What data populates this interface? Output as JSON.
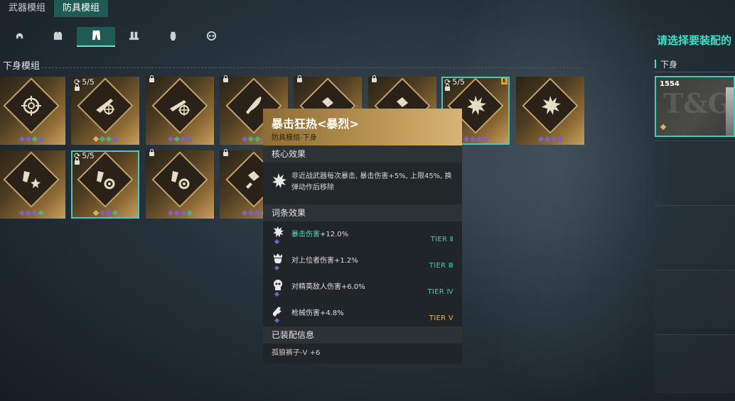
{
  "tabs": [
    {
      "label": "武器模组",
      "active": false
    },
    {
      "label": "防具模组",
      "active": true
    }
  ],
  "categories": [
    {
      "icon": "helmet-icon",
      "active": false
    },
    {
      "icon": "chest-armor-icon",
      "active": false
    },
    {
      "icon": "pants-icon",
      "active": true
    },
    {
      "icon": "boots-icon",
      "active": false
    },
    {
      "icon": "gloves-icon",
      "active": false
    },
    {
      "icon": "mask-icon",
      "active": false
    }
  ],
  "section_label": "下身模组",
  "cards": [
    {
      "icon": "target-icon",
      "counter": "",
      "locked": false,
      "selected": false,
      "badge": "",
      "dots": [
        "#7a63c4",
        "#7a63c4",
        "#4fae80",
        "#7a63c4"
      ]
    },
    {
      "icon": "sniper-rifle-icon",
      "counter": "5/5",
      "locked": true,
      "selected": false,
      "badge": "",
      "dots": [
        "#d8b35e",
        "#4fae80",
        "#4fae80",
        "#7a63c4"
      ]
    },
    {
      "icon": "rifle-target-icon",
      "counter": "",
      "locked": true,
      "selected": false,
      "badge": "",
      "dots": [
        "#7a63c4",
        "#4fae80",
        "#7a63c4",
        "#7a63c4"
      ]
    },
    {
      "icon": "knife-icon",
      "counter": "",
      "locked": true,
      "selected": false,
      "badge": "",
      "dots": [
        "#7a63c4",
        "#4fae80",
        "#4fae80",
        "#7a63c4"
      ]
    },
    {
      "icon": "ammo-icon",
      "counter": "",
      "locked": true,
      "selected": false,
      "badge": "",
      "dots": [
        "#7a63c4",
        "#7a63c4",
        "#7a63c4",
        "#7a63c4"
      ]
    },
    {
      "icon": "ammo-icon",
      "counter": "",
      "locked": true,
      "selected": false,
      "badge": "",
      "dots": [
        "#7a63c4",
        "#7a63c4",
        "#7a63c4",
        "#7a63c4"
      ]
    },
    {
      "icon": "crit-burst-icon",
      "counter": "5/5",
      "locked": true,
      "selected": true,
      "badge": "E",
      "dots": [
        "#7a63c4",
        "#7a63c4",
        "#7a63c4",
        "#7a63c4"
      ]
    },
    {
      "icon": "crit-burst-icon",
      "counter": "",
      "locked": false,
      "selected": false,
      "badge": "",
      "dots": [
        "#7a63c4",
        "#7a63c4",
        "#7a63c4",
        "#7a63c4"
      ]
    },
    {
      "icon": "ammo-star-icon",
      "counter": "",
      "locked": false,
      "selected": false,
      "badge": "",
      "dots": [
        "#7a63c4",
        "#7a63c4",
        "#7a63c4",
        "#4fae80"
      ]
    },
    {
      "icon": "ammo-gear-icon",
      "counter": "5/5",
      "locked": true,
      "selected": true,
      "badge": "",
      "dots": [
        "#d8b35e",
        "#7a63c4",
        "#7a63c4",
        "#4fae80"
      ]
    },
    {
      "icon": "ammo-gear-icon",
      "counter": "",
      "locked": true,
      "selected": false,
      "badge": "",
      "dots": [
        "#7a63c4",
        "#7a63c4",
        "#7a63c4",
        "#4fae80"
      ]
    },
    {
      "icon": "ammo-icon",
      "counter": "",
      "locked": true,
      "selected": false,
      "badge": "",
      "dots": [
        "#7a63c4",
        "#7a63c4",
        "#7a63c4",
        "#4fae80"
      ]
    }
  ],
  "tooltip": {
    "title": "暴击狂热<暴烈>",
    "subtitle": "防具模组-下身",
    "core_header": "核心效果",
    "core_text": "非近战武器每次暴击, 暴击伤害+5%, 上限45%, 换弹动作后移除",
    "perks_header": "词条效果",
    "perks": [
      {
        "icon": "crit-burst-icon",
        "highlight": "暴击伤害",
        "text": "+12.0%",
        "tier": "TIER Ⅱ",
        "tier_color": "#4fc7a8"
      },
      {
        "icon": "crown-skull-icon",
        "highlight": "",
        "text": "对上位者伤害+1.2%",
        "tier": "TIER Ⅲ",
        "tier_color": "#4fc7a8"
      },
      {
        "icon": "elite-head-icon",
        "highlight": "",
        "text": "对精英敌人伤害+6.0%",
        "tier": "TIER Ⅳ",
        "tier_color": "#4fc7a8"
      },
      {
        "icon": "gun-icon",
        "highlight": "",
        "text": "枪械伤害+4.8%",
        "tier": "TIER Ⅴ",
        "tier_color": "#e5b34c"
      }
    ],
    "equip_header": "已装配信息",
    "equip_text": "孤狼裤子-Ⅴ +6"
  },
  "right_panel": {
    "title": "请选择要装配的",
    "label": "下身",
    "item_number": "1554",
    "item_logo": "T&G"
  }
}
